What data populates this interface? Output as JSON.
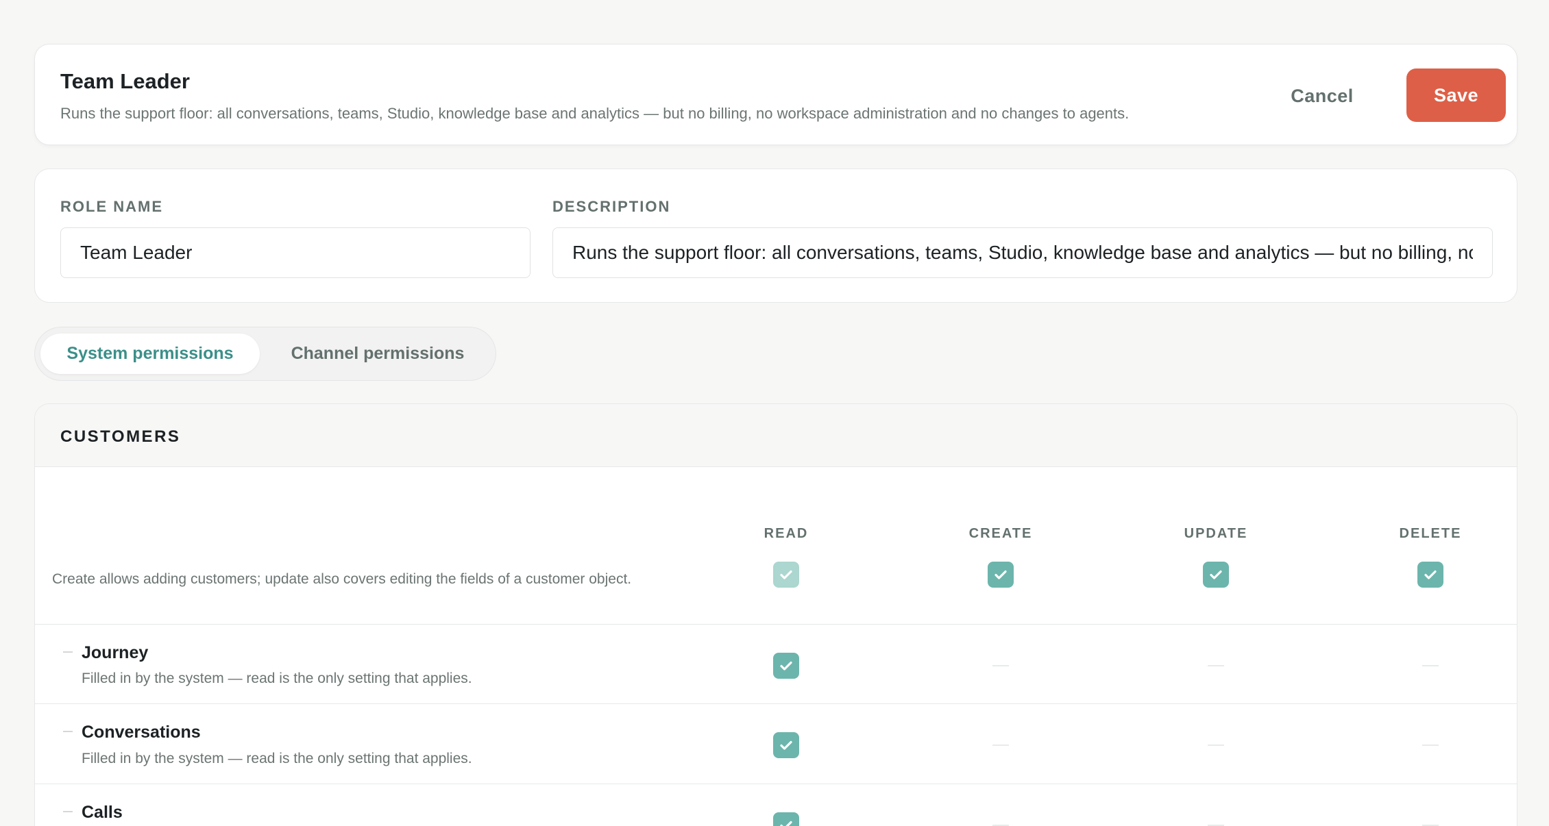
{
  "header": {
    "title": "Team Leader",
    "description": "Runs the support floor: all conversations, teams, Studio, knowledge base and analytics — but no billing, no workspace administration and no changes to agents.",
    "cancel_label": "Cancel",
    "save_label": "Save"
  },
  "form": {
    "role_name_label": "ROLE NAME",
    "role_name_value": "Team Leader",
    "description_label": "DESCRIPTION",
    "description_value": "Runs the support floor: all conversations, teams, Studio, knowledge base and analytics — but no billing, no workspace administration and no changes to agents."
  },
  "tabs": [
    {
      "label": "System permissions",
      "active": true
    },
    {
      "label": "Channel permissions",
      "active": false
    }
  ],
  "section": {
    "title": "CUSTOMERS",
    "columns": [
      "READ",
      "CREATE",
      "UPDATE",
      "DELETE"
    ],
    "note": "Create allows adding customers; update also covers editing the fields of a customer object.",
    "main_permissions": {
      "read": true,
      "read_locked": true,
      "create": true,
      "update": true,
      "delete": true
    },
    "rows": [
      {
        "title": "Journey",
        "description": "Filled in by the system — read is the only setting that applies.",
        "read": true
      },
      {
        "title": "Conversations",
        "description": "Filled in by the system — read is the only setting that applies.",
        "read": true
      },
      {
        "title": "Calls",
        "description": "",
        "read": true
      }
    ]
  },
  "colors": {
    "accent": "#3b8f89",
    "checkbox": "#6cb5ac",
    "checkbox_disabled": "#acd6d0",
    "save_button": "#de5f47"
  }
}
